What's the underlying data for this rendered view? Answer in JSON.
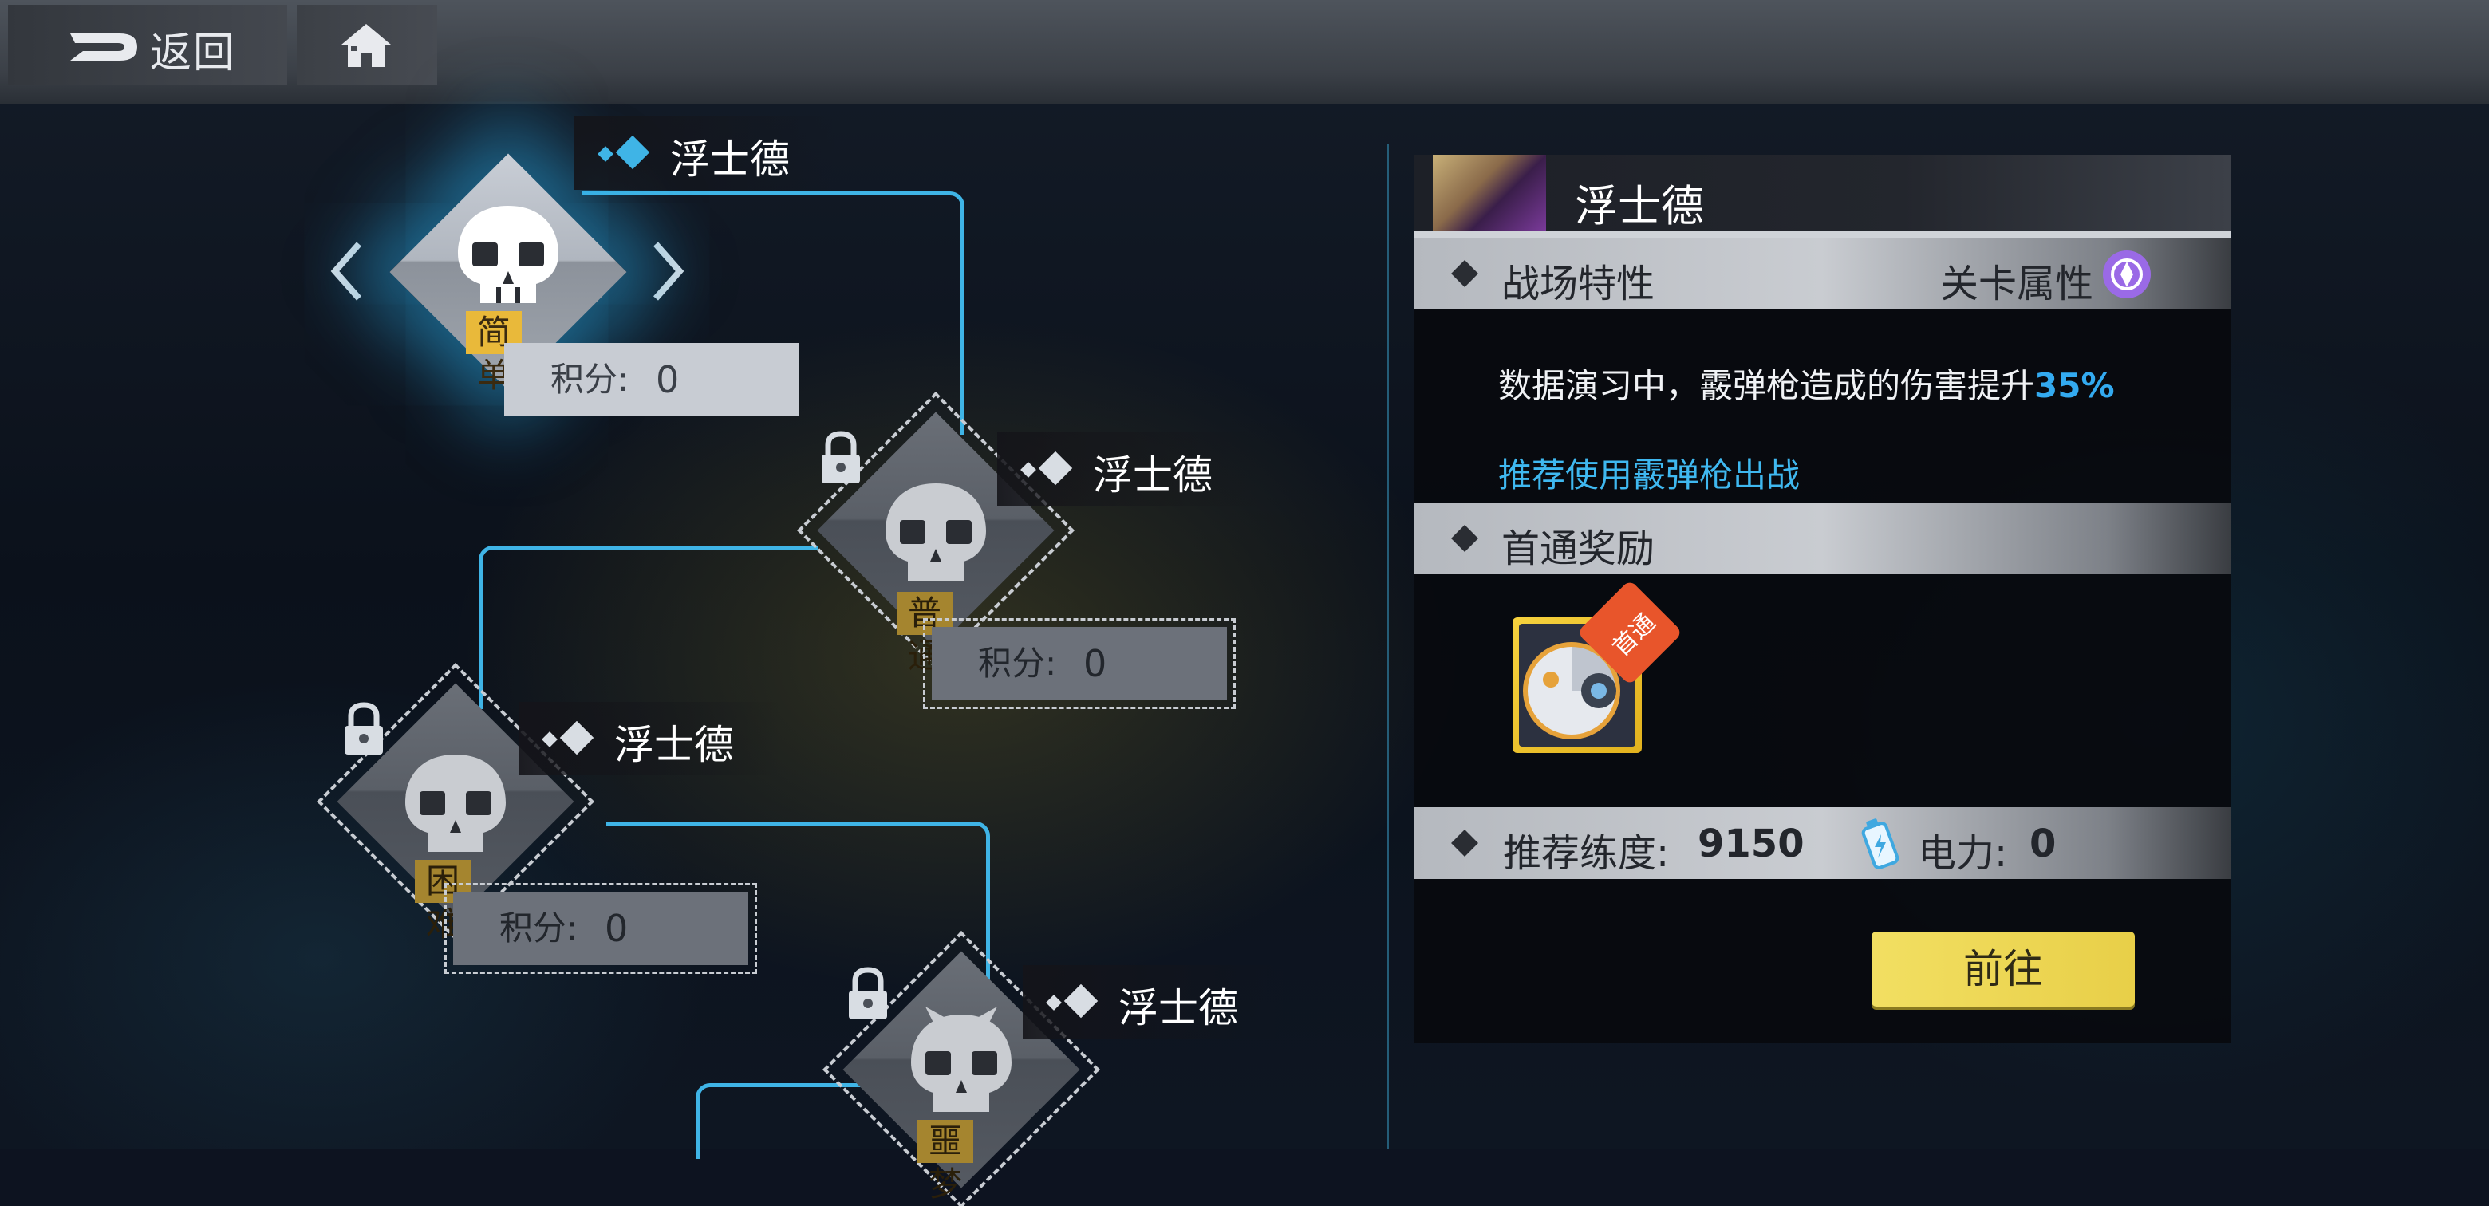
{
  "topbar": {
    "back_label": "返回",
    "back_icon": "back-arrow-icon",
    "home_icon": "home-icon"
  },
  "stages": [
    {
      "name": "浮士德",
      "difficulty": "简单",
      "score_label": "积分:",
      "score": "0",
      "locked": false,
      "selected": true
    },
    {
      "name": "浮士德",
      "difficulty": "普通",
      "score_label": "积分:",
      "score": "0",
      "locked": true,
      "selected": false
    },
    {
      "name": "浮士德",
      "difficulty": "困难",
      "score_label": "积分:",
      "score": "0",
      "locked": true,
      "selected": false
    },
    {
      "name": "浮士德",
      "difficulty": "噩梦",
      "score_label": "",
      "score": "",
      "locked": true,
      "selected": false
    }
  ],
  "panel": {
    "title": "浮士德",
    "battlefield": {
      "label": "战场特性",
      "attr_label": "关卡属性",
      "desc_prefix": "数据演习中，霰弹枪造成的伤害提升",
      "desc_highlight": "35%",
      "recommend": "推荐使用霰弹枪出战"
    },
    "reward": {
      "label": "首通奖励",
      "badge": "首通"
    },
    "stats": {
      "level_label": "推荐练度:",
      "level_value": "9150",
      "power_label": "电力:",
      "power_value": "0"
    },
    "go_button": "前往"
  },
  "colors": {
    "accent_blue": "#3fb4e6",
    "tag_yellow": "#e9b93a",
    "button_yellow": "#f2df62",
    "highlight_blue": "#33aaf0"
  }
}
